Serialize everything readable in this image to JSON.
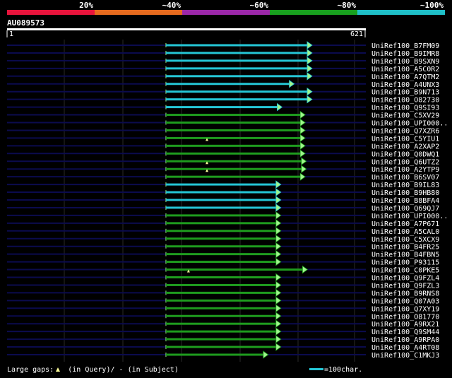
{
  "scale": {
    "labels": [
      "20%",
      "~40%",
      "~60%",
      "~80%",
      "~100%"
    ],
    "colors": [
      "#e8143c",
      "#e66a1e",
      "#9b27a8",
      "#18a01e",
      "#1fbfc8"
    ]
  },
  "query": {
    "id": "AU089573",
    "start_label": "1",
    "end_label": "621",
    "length": 621
  },
  "colors": {
    "background": "#000000",
    "query_bar": "#ffffff",
    "guide_line": "#0b0b4e",
    "grid_line": "#2a2a2a",
    "hit_high": "#25c6d6",
    "hit_medium": "#1e9c1e",
    "arrow_fill": "#9ff58c",
    "gap_marker": "#ffff9a"
  },
  "hits": [
    {
      "label": "UniRef100_B7FM09",
      "score_class": "high",
      "start": 275,
      "end": 528
    },
    {
      "label": "UniRef100_B9IMR8",
      "score_class": "high",
      "start": 275,
      "end": 528
    },
    {
      "label": "UniRef100_B9SXN9",
      "score_class": "high",
      "start": 275,
      "end": 528
    },
    {
      "label": "UniRef100_A5C0R2",
      "score_class": "high",
      "start": 275,
      "end": 528
    },
    {
      "label": "UniRef100_A7QTM2",
      "score_class": "high",
      "start": 275,
      "end": 528
    },
    {
      "label": "UniRef100_A4UNX3",
      "score_class": "high",
      "start": 275,
      "end": 497
    },
    {
      "label": "UniRef100_B9N713",
      "score_class": "high",
      "start": 275,
      "end": 528
    },
    {
      "label": "UniRef100_O82730",
      "score_class": "high",
      "start": 275,
      "end": 528
    },
    {
      "label": "UniRef100_Q9SI93",
      "score_class": "high",
      "start": 275,
      "end": 476
    },
    {
      "label": "UniRef100_C5XV29",
      "score_class": "medium",
      "start": 275,
      "end": 516
    },
    {
      "label": "UniRef100_UPI000..",
      "score_class": "medium",
      "start": 275,
      "end": 516
    },
    {
      "label": "UniRef100_Q7XZR6",
      "score_class": "medium",
      "start": 275,
      "end": 516
    },
    {
      "label": "UniRef100_C5YIU1",
      "score_class": "medium",
      "start": 275,
      "end": 516,
      "gaps": [
        346
      ]
    },
    {
      "label": "UniRef100_A2XAP2",
      "score_class": "medium",
      "start": 275,
      "end": 516
    },
    {
      "label": "UniRef100_Q0DWQ1",
      "score_class": "medium",
      "start": 275,
      "end": 516
    },
    {
      "label": "UniRef100_Q6UTZ2",
      "score_class": "medium",
      "start": 275,
      "end": 518,
      "gaps": [
        346
      ]
    },
    {
      "label": "UniRef100_A2YTP9",
      "score_class": "medium",
      "start": 275,
      "end": 518,
      "gaps": [
        346
      ]
    },
    {
      "label": "UniRef100_B6SV07",
      "score_class": "medium",
      "start": 275,
      "end": 516
    },
    {
      "label": "UniRef100_B9IL83",
      "score_class": "high",
      "start": 275,
      "end": 474
    },
    {
      "label": "UniRef100_B9HB80",
      "score_class": "high",
      "start": 275,
      "end": 474
    },
    {
      "label": "UniRef100_B8BFA4",
      "score_class": "high",
      "start": 275,
      "end": 474
    },
    {
      "label": "UniRef100_Q69QJ7",
      "score_class": "high",
      "start": 275,
      "end": 474
    },
    {
      "label": "UniRef100_UPI000..",
      "score_class": "medium",
      "start": 275,
      "end": 474
    },
    {
      "label": "UniRef100_A7P671",
      "score_class": "medium",
      "start": 275,
      "end": 474
    },
    {
      "label": "UniRef100_A5CAL0",
      "score_class": "medium",
      "start": 275,
      "end": 474
    },
    {
      "label": "UniRef100_C5XCX9",
      "score_class": "medium",
      "start": 275,
      "end": 474
    },
    {
      "label": "UniRef100_B4FR25",
      "score_class": "medium",
      "start": 275,
      "end": 474
    },
    {
      "label": "UniRef100_B4FBN5",
      "score_class": "medium",
      "start": 275,
      "end": 474
    },
    {
      "label": "UniRef100_P93115",
      "score_class": "medium",
      "start": 275,
      "end": 474
    },
    {
      "label": "UniRef100_C0PKE5",
      "score_class": "medium",
      "start": 275,
      "end": 520,
      "gaps": [
        314
      ]
    },
    {
      "label": "UniRef100_Q9FZL4",
      "score_class": "medium",
      "start": 275,
      "end": 474
    },
    {
      "label": "UniRef100_Q9FZL3",
      "score_class": "medium",
      "start": 275,
      "end": 474
    },
    {
      "label": "UniRef100_B9RNS8",
      "score_class": "medium",
      "start": 275,
      "end": 474
    },
    {
      "label": "UniRef100_Q07A03",
      "score_class": "medium",
      "start": 275,
      "end": 474
    },
    {
      "label": "UniRef100_Q7XY19",
      "score_class": "medium",
      "start": 275,
      "end": 474
    },
    {
      "label": "UniRef100_O81770",
      "score_class": "medium",
      "start": 275,
      "end": 474
    },
    {
      "label": "UniRef100_A9RX21",
      "score_class": "medium",
      "start": 275,
      "end": 474
    },
    {
      "label": "UniRef100_Q9SM44",
      "score_class": "medium",
      "start": 275,
      "end": 474
    },
    {
      "label": "UniRef100_A9RPA0",
      "score_class": "medium",
      "start": 275,
      "end": 474
    },
    {
      "label": "UniRef100_A4RT08",
      "score_class": "medium",
      "start": 275,
      "end": 474
    },
    {
      "label": "UniRef100_C1MKJ3",
      "score_class": "medium",
      "start": 275,
      "end": 452
    }
  ],
  "footer": {
    "gaps_prefix": "Large gaps:",
    "gaps_query_text": "(in Query)/",
    "gaps_subject_marker": "-",
    "gaps_subject_text": "(in Subject)",
    "legend_text": "=100char."
  }
}
